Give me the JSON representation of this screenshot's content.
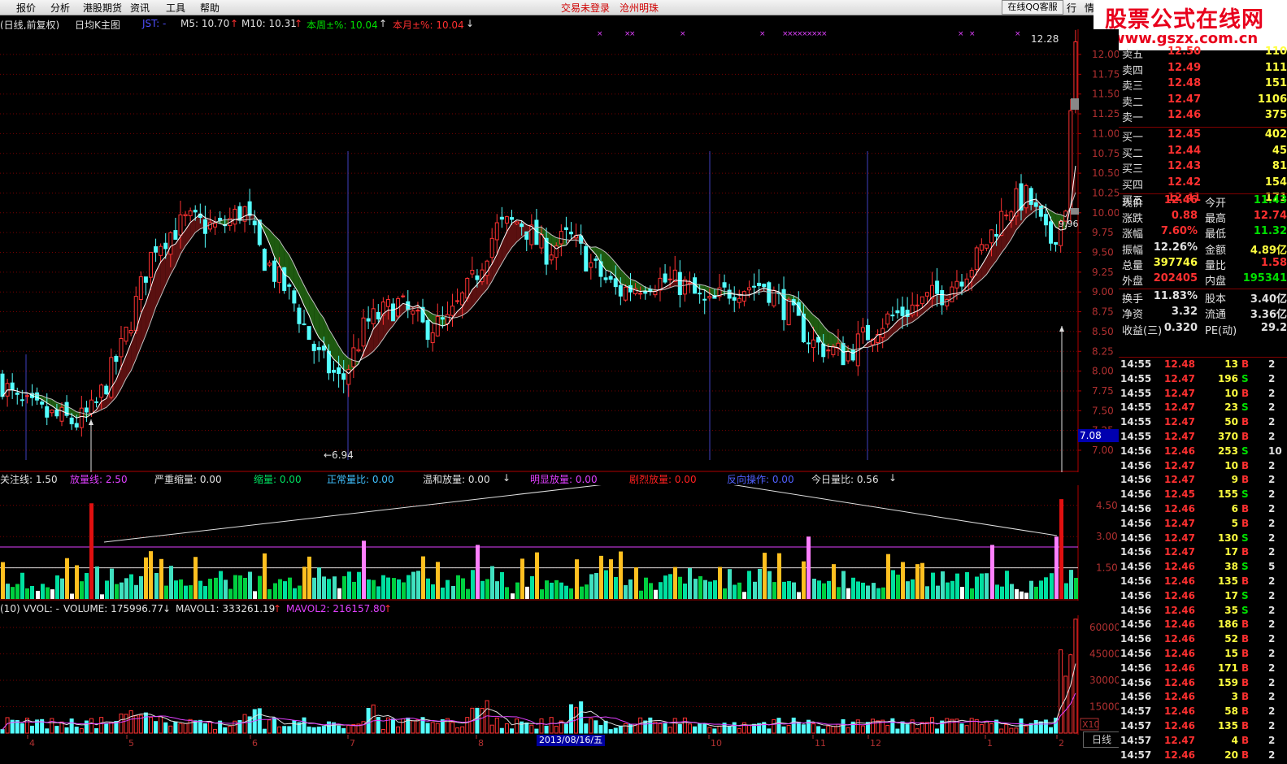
{
  "menu": {
    "items": [
      "报价",
      "分析",
      "港股期货",
      "资讯",
      "工具",
      "帮助"
    ],
    "center": [
      "交易未登录",
      "沧州明珠"
    ],
    "qq": "在线QQ客服",
    "right_btns": [
      "行",
      "情"
    ]
  },
  "brand": {
    "title": "股票公式在线网",
    "url": "www.gszx.com.cn"
  },
  "main_info": {
    "period": "(日线,前复权)",
    "name": "日均K主图",
    "jst": "JST: -",
    "m5": "M5: 10.70",
    "m10": "M10: 10.31",
    "week": "本周±%: 10.04",
    "month": "本月±%: 10.04"
  },
  "price_axis": [
    "12.00",
    "11.75",
    "11.50",
    "11.25",
    "11.00",
    "10.75",
    "10.50",
    "10.25",
    "10.00",
    "9.75",
    "9.50",
    "9.25",
    "9.00",
    "8.75",
    "8.50",
    "8.25",
    "8.00",
    "7.75",
    "7.50",
    "7.25",
    "7.00"
  ],
  "price_annot": {
    "high": "12.28",
    "low": "6.94",
    "mid": "9.96",
    "cur": "7.08"
  },
  "ind_info": {
    "guanzhu": "关注线: 1.50",
    "fangliang": "放量线: 2.50",
    "yanzhong": "严重缩量: 0.00",
    "suoliang": "缩量: 0.00",
    "zhengchang": "正常量比: 0.00",
    "wenhe": "温和放量: 0.00",
    "mingxian": "明显放量: 0.00",
    "julie": "剧烈放量: 0.00",
    "fanxiang": "反向操作: 0.00",
    "jinri": "今日量比: 0.56"
  },
  "ind_axis": [
    "4.50",
    "3.00",
    "1.50"
  ],
  "vol_info": {
    "name": "(10) VVOL: -",
    "volume": "VOLUME: 175996.77",
    "mavol1": "MAVOL1: 333261.19",
    "mavol2": "MAVOL2: 216157.80"
  },
  "vol_axis": [
    "60000",
    "45000",
    "30000",
    "15000",
    "X10"
  ],
  "date_axis": [
    "4",
    "5",
    "6",
    "7",
    "8",
    "10",
    "11",
    "12",
    "1",
    "2"
  ],
  "date_cursor": "2013/08/16/五",
  "period_btn": "日线",
  "order_book": {
    "sell": [
      {
        "label": "卖五",
        "price": "12.50",
        "vol": "110"
      },
      {
        "label": "卖四",
        "price": "12.49",
        "vol": "111"
      },
      {
        "label": "卖三",
        "price": "12.48",
        "vol": "151"
      },
      {
        "label": "卖二",
        "price": "12.47",
        "vol": "1106"
      },
      {
        "label": "卖一",
        "price": "12.46",
        "vol": "375"
      }
    ],
    "buy": [
      {
        "label": "买一",
        "price": "12.45",
        "vol": "402"
      },
      {
        "label": "买二",
        "price": "12.44",
        "vol": "45"
      },
      {
        "label": "买三",
        "price": "12.43",
        "vol": "81"
      },
      {
        "label": "买四",
        "price": "12.42",
        "vol": "154"
      },
      {
        "label": "买五",
        "price": "12.41",
        "vol": "171"
      }
    ]
  },
  "quote": [
    {
      "l1": "现价",
      "v1": "12.46",
      "l2": "今开",
      "v2": "11.43",
      "c1": "#ff3030",
      "c2": "#00e000"
    },
    {
      "l1": "涨跌",
      "v1": "0.88",
      "l2": "最高",
      "v2": "12.74",
      "c1": "#ff3030",
      "c2": "#ff3030"
    },
    {
      "l1": "涨幅",
      "v1": "7.60%",
      "l2": "最低",
      "v2": "11.32",
      "c1": "#ff3030",
      "c2": "#00e000"
    },
    {
      "l1": "振幅",
      "v1": "12.26%",
      "l2": "金额",
      "v2": "4.89亿",
      "c1": "#e0e0e0",
      "c2": "#ffff40"
    },
    {
      "l1": "总量",
      "v1": "397746",
      "l2": "量比",
      "v2": "1.58",
      "c1": "#ffff40",
      "c2": "#ff3030"
    },
    {
      "l1": "外盘",
      "v1": "202405",
      "l2": "内盘",
      "v2": "195341",
      "c1": "#ff3030",
      "c2": "#00e000"
    },
    {
      "l1": "换手",
      "v1": "11.83%",
      "l2": "股本",
      "v2": "3.40亿",
      "c1": "#e0e0e0",
      "c2": "#e0e0e0"
    },
    {
      "l1": "净资",
      "v1": "3.32",
      "l2": "流通",
      "v2": "3.36亿",
      "c1": "#e0e0e0",
      "c2": "#e0e0e0"
    },
    {
      "l1": "收益(三)",
      "v1": "0.320",
      "l2": "PE(动)",
      "v2": "29.2",
      "c1": "#e0e0e0",
      "c2": "#e0e0e0"
    }
  ],
  "ticks": [
    [
      "14:55",
      "12.48",
      "13",
      "B",
      "2"
    ],
    [
      "14:55",
      "12.47",
      "196",
      "S",
      "2"
    ],
    [
      "14:55",
      "12.47",
      "10",
      "B",
      "2"
    ],
    [
      "14:55",
      "12.47",
      "23",
      "S",
      "2"
    ],
    [
      "14:55",
      "12.47",
      "50",
      "B",
      "2"
    ],
    [
      "14:55",
      "12.47",
      "370",
      "B",
      "2"
    ],
    [
      "14:56",
      "12.46",
      "253",
      "S",
      "10"
    ],
    [
      "14:56",
      "12.47",
      "10",
      "B",
      "2"
    ],
    [
      "14:56",
      "12.47",
      "9",
      "B",
      "2"
    ],
    [
      "14:56",
      "12.45",
      "155",
      "S",
      "2"
    ],
    [
      "14:56",
      "12.46",
      "6",
      "B",
      "2"
    ],
    [
      "14:56",
      "12.47",
      "5",
      "B",
      "2"
    ],
    [
      "14:56",
      "12.47",
      "130",
      "S",
      "2"
    ],
    [
      "14:56",
      "12.47",
      "17",
      "B",
      "2"
    ],
    [
      "14:56",
      "12.46",
      "38",
      "S",
      "5"
    ],
    [
      "14:56",
      "12.46",
      "135",
      "B",
      "2"
    ],
    [
      "14:56",
      "12.46",
      "17",
      "S",
      "2"
    ],
    [
      "14:56",
      "12.46",
      "35",
      "S",
      "2"
    ],
    [
      "14:56",
      "12.46",
      "186",
      "B",
      "2"
    ],
    [
      "14:56",
      "12.46",
      "52",
      "B",
      "2"
    ],
    [
      "14:56",
      "12.46",
      "15",
      "B",
      "2"
    ],
    [
      "14:56",
      "12.46",
      "171",
      "B",
      "2"
    ],
    [
      "14:56",
      "12.46",
      "159",
      "B",
      "2"
    ],
    [
      "14:56",
      "12.46",
      "3",
      "B",
      "2"
    ],
    [
      "14:57",
      "12.46",
      "58",
      "B",
      "2"
    ],
    [
      "14:57",
      "12.46",
      "135",
      "B",
      "2"
    ],
    [
      "14:57",
      "12.47",
      "4",
      "B",
      "2"
    ],
    [
      "14:57",
      "12.46",
      "20",
      "B",
      "2"
    ]
  ],
  "colors": {
    "up": "#ff3232",
    "down": "#54ffff",
    "ma": "#ffffff",
    "ribbon_up": "#5a1010",
    "ribbon_dn": "#1e5a10"
  }
}
